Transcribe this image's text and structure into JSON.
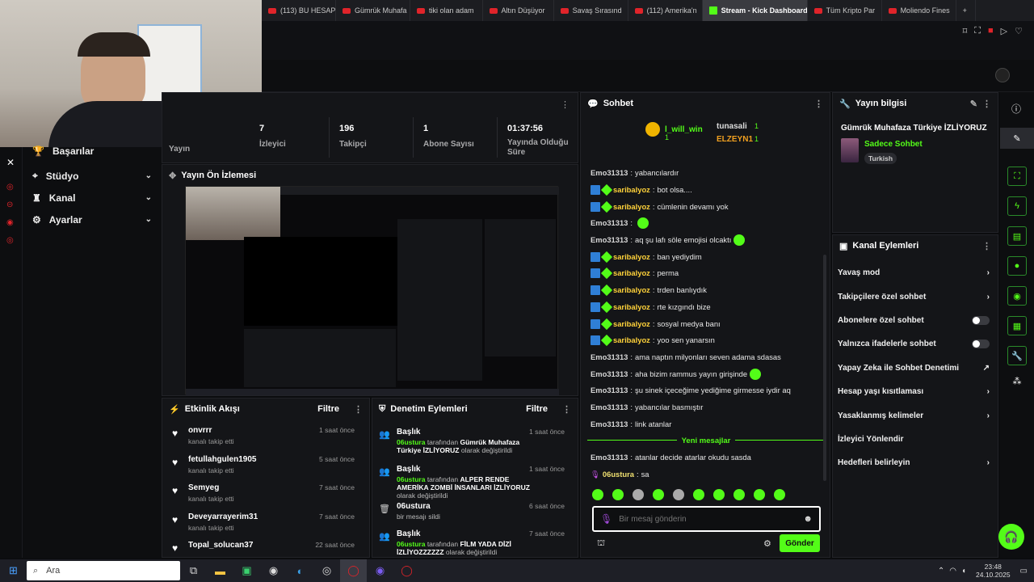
{
  "browser": {
    "tabs": [
      {
        "label": "(113) BU HESAP"
      },
      {
        "label": "Gümrük Muhafa"
      },
      {
        "label": "tiki olan adam"
      },
      {
        "label": "Altın Düşüyor"
      },
      {
        "label": "Savaş Sırasınd"
      },
      {
        "label": "(112) Amerika'n"
      },
      {
        "label": "Stream - Kick Dashboard",
        "active": true
      },
      {
        "label": "Tüm Kripto Par"
      },
      {
        "label": "Moliendo Fines"
      }
    ],
    "new_tab": "+"
  },
  "nav": {
    "items": [
      {
        "label": "Başarılar"
      },
      {
        "label": "Stüdyo"
      },
      {
        "label": "Kanal"
      },
      {
        "label": "Ayarlar"
      }
    ]
  },
  "stats": {
    "items": [
      {
        "value": "7",
        "label": "Yayın"
      },
      {
        "value": "",
        "label": "İzleyici"
      },
      {
        "value": "196",
        "label": "Takipçi"
      },
      {
        "value": "1",
        "label": "Abone Sayısı"
      },
      {
        "value": "01:37:56",
        "label": "Yayında Olduğu Süre"
      }
    ]
  },
  "preview": {
    "title": "Yayın Ön İzlemesi"
  },
  "activity": {
    "title": "Etkinlik Akışı",
    "filter": "Filtre",
    "rows": [
      {
        "name": "onvrrr",
        "sub": "kanalı takip etti",
        "time": "1 saat önce"
      },
      {
        "name": "fetullahgulen1905",
        "sub": "kanalı takip etti",
        "time": "5 saat önce"
      },
      {
        "name": "Semyeg",
        "sub": "kanalı takip etti",
        "time": "7 saat önce"
      },
      {
        "name": "Deveyarrayerim31",
        "sub": "kanalı takip etti",
        "time": "7 saat önce"
      },
      {
        "name": "Topal_solucan37",
        "sub": "",
        "time": "22 saat önce"
      }
    ]
  },
  "modlog": {
    "title": "Denetim Eylemleri",
    "filter": "Filtre",
    "rows": [
      {
        "title": "Başlık",
        "who": "06ustura",
        "mid": "tarafından",
        "value": "Gümrük Muhafaza Türkiye İZLİYORUZ",
        "tail": "olarak değiştirildi",
        "time": "1 saat önce"
      },
      {
        "title": "Başlık",
        "who": "06ustura",
        "mid": "tarafından",
        "value": "ALPER RENDE AMERİKA ZOMBİ İNSANLARI İZLİYORUZ",
        "tail": "olarak değiştirildi",
        "time": "1 saat önce"
      },
      {
        "title": "06ustura",
        "who": "",
        "mid": "",
        "value": "",
        "tail": "bir mesajı sildi",
        "time": "6 saat önce"
      },
      {
        "title": "Başlık",
        "who": "06ustura",
        "mid": "tarafından",
        "value": "FİLM YADA DİZİ İZLİYOZZZZZZ",
        "tail": "olarak değiştirildi",
        "time": "7 saat önce"
      }
    ]
  },
  "chat": {
    "title": "Sohbet",
    "top_user": "l_will_win",
    "top_count": "1",
    "top2_user": "tunasali",
    "top2_count": "1",
    "top3_user": "ELZEYN1",
    "top3_count": "1",
    "messages": [
      {
        "user": "Emo31313",
        "text": "yabancılardır",
        "badges": false,
        "emote": false
      },
      {
        "user": "saribalyoz",
        "text": "bot olsa....",
        "badges": true,
        "emote": false
      },
      {
        "user": "saribalyoz",
        "text": "cümlenin devamı yok",
        "badges": true,
        "emote": false
      },
      {
        "user": "Emo31313",
        "text": "",
        "badges": false,
        "emote": true
      },
      {
        "user": "Emo31313",
        "text": "aq şu lafı söle emojisi olcaktı",
        "badges": false,
        "emote": true
      },
      {
        "user": "saribalyoz",
        "text": "ban yediydim",
        "badges": true,
        "emote": false
      },
      {
        "user": "saribalyoz",
        "text": "perma",
        "badges": true,
        "emote": false
      },
      {
        "user": "saribalyoz",
        "text": "trden banlıydık",
        "badges": true,
        "emote": false
      },
      {
        "user": "saribalyoz",
        "text": "rte kızgındı bize",
        "badges": true,
        "emote": false
      },
      {
        "user": "saribalyoz",
        "text": "sosyal medya banı",
        "badges": true,
        "emote": false
      },
      {
        "user": "saribalyoz",
        "text": "yoo sen yanarsın",
        "badges": true,
        "emote": false
      },
      {
        "user": "Emo31313",
        "text": "ama naptın milyonları seven adama sdasas",
        "badges": false,
        "emote": false
      },
      {
        "user": "Emo31313",
        "text": "aha bizim rammus yayın girişinde",
        "badges": false,
        "emote": true
      },
      {
        "user": "Emo31313",
        "text": "şu sinek içeceğime yediğime girmesse iydir aq",
        "badges": false,
        "emote": false
      },
      {
        "user": "Emo31313",
        "text": "yabancılar basmıştır",
        "badges": false,
        "emote": false
      },
      {
        "user": "Emo31313",
        "text": "link atanlar",
        "badges": false,
        "emote": false
      }
    ],
    "new_messages": "Yeni mesajlar",
    "after": [
      {
        "user": "Emo31313",
        "text": "atanlar decide atarlar okudu sasda"
      },
      {
        "user": "06ustura",
        "text": "sa"
      }
    ],
    "placeholder": "Bir mesaj gönderin",
    "send": "Gönder"
  },
  "info": {
    "title": "Yayın bilgisi",
    "stream_title": "Gümrük Muhafaza Türkiye İZLİYORUZ",
    "category": "Sadece Sohbet",
    "tag": "Turkish"
  },
  "actions": {
    "title": "Kanal Eylemleri",
    "rows": [
      {
        "label": "Yavaş mod",
        "kind": "chevron"
      },
      {
        "label": "Takipçilere özel sohbet",
        "kind": "chevron"
      },
      {
        "label": "Abonelere özel sohbet",
        "kind": "toggle"
      },
      {
        "label": "Yalnızca ifadelerle sohbet",
        "kind": "toggle"
      },
      {
        "label": "Yapay Zeka ile Sohbet Denetimi",
        "kind": "link"
      },
      {
        "label": "Hesap yaşı kısıtlaması",
        "kind": "chevron"
      },
      {
        "label": "Yasaklanmış kelimeler",
        "kind": "chevron"
      },
      {
        "label": "İzleyici Yönlendir",
        "kind": "none"
      },
      {
        "label": "Hedefleri belirleyin",
        "kind": "chevron"
      }
    ]
  },
  "taskbar": {
    "search": "Ara",
    "time": "23:48",
    "date": "24.10.2025"
  },
  "colors": {
    "accent": "#53fc18",
    "bg": "#0b0c0e",
    "panel": "#141518"
  }
}
